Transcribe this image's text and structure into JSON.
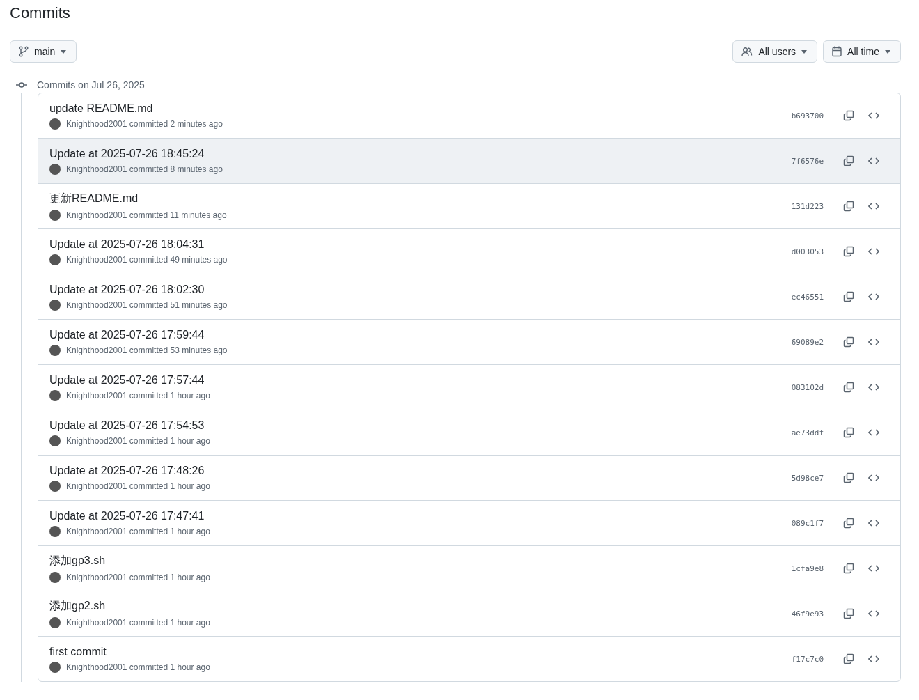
{
  "title": "Commits",
  "branch_button": {
    "label": "main"
  },
  "filters": [
    {
      "kind": "users",
      "label": "All users"
    },
    {
      "kind": "time",
      "label": "All time"
    }
  ],
  "group": {
    "heading": "Commits on Jul 26, 2025",
    "commits": [
      {
        "message": "update README.md",
        "author": "Knighthood2001",
        "action": "committed",
        "time": "2 minutes ago",
        "sha": "b693700",
        "highlighted": false
      },
      {
        "message": "Update at 2025-07-26 18:45:24",
        "author": "Knighthood2001",
        "action": "committed",
        "time": "8 minutes ago",
        "sha": "7f6576e",
        "highlighted": true
      },
      {
        "message": "更新README.md",
        "author": "Knighthood2001",
        "action": "committed",
        "time": "11 minutes ago",
        "sha": "131d223",
        "highlighted": false
      },
      {
        "message": "Update at 2025-07-26 18:04:31",
        "author": "Knighthood2001",
        "action": "committed",
        "time": "49 minutes ago",
        "sha": "d003053",
        "highlighted": false
      },
      {
        "message": "Update at 2025-07-26 18:02:30",
        "author": "Knighthood2001",
        "action": "committed",
        "time": "51 minutes ago",
        "sha": "ec46551",
        "highlighted": false
      },
      {
        "message": "Update at 2025-07-26 17:59:44",
        "author": "Knighthood2001",
        "action": "committed",
        "time": "53 minutes ago",
        "sha": "69089e2",
        "highlighted": false
      },
      {
        "message": "Update at 2025-07-26 17:57:44",
        "author": "Knighthood2001",
        "action": "committed",
        "time": "1 hour ago",
        "sha": "083102d",
        "highlighted": false
      },
      {
        "message": "Update at 2025-07-26 17:54:53",
        "author": "Knighthood2001",
        "action": "committed",
        "time": "1 hour ago",
        "sha": "ae73ddf",
        "highlighted": false
      },
      {
        "message": "Update at 2025-07-26 17:48:26",
        "author": "Knighthood2001",
        "action": "committed",
        "time": "1 hour ago",
        "sha": "5d98ce7",
        "highlighted": false
      },
      {
        "message": "Update at 2025-07-26 17:47:41",
        "author": "Knighthood2001",
        "action": "committed",
        "time": "1 hour ago",
        "sha": "089c1f7",
        "highlighted": false
      },
      {
        "message": "添加gp3.sh",
        "author": "Knighthood2001",
        "action": "committed",
        "time": "1 hour ago",
        "sha": "1cfa9e8",
        "highlighted": false
      },
      {
        "message": "添加gp2.sh",
        "author": "Knighthood2001",
        "action": "committed",
        "time": "1 hour ago",
        "sha": "46f9e93",
        "highlighted": false
      },
      {
        "message": "first commit",
        "author": "Knighthood2001",
        "action": "committed",
        "time": "1 hour ago",
        "sha": "f17c7c0",
        "highlighted": false
      }
    ]
  }
}
